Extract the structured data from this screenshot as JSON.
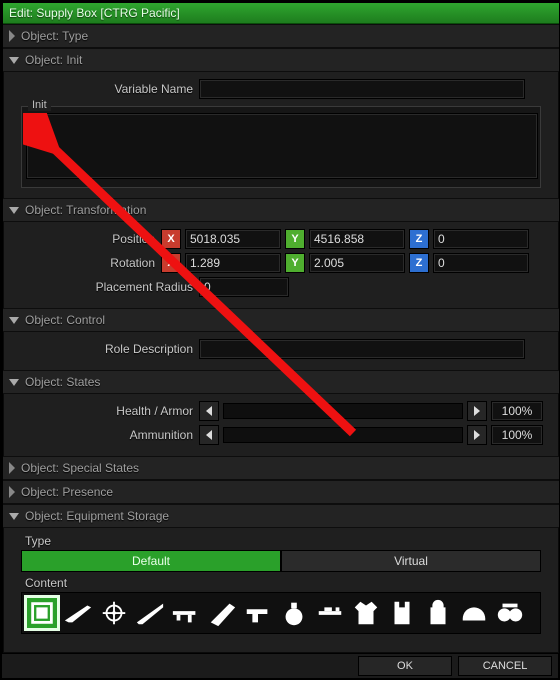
{
  "window": {
    "title": "Edit: Supply Box [CTRG Pacific]"
  },
  "sections": {
    "type": {
      "label": "Object: Type",
      "open": false
    },
    "init": {
      "label": "Object: Init",
      "open": true
    },
    "transformation": {
      "label": "Object: Transformation",
      "open": true
    },
    "control": {
      "label": "Object: Control",
      "open": true
    },
    "states": {
      "label": "Object: States",
      "open": true
    },
    "special_states": {
      "label": "Object: Special States",
      "open": false
    },
    "presence": {
      "label": "Object: Presence",
      "open": false
    },
    "equipment": {
      "label": "Object: Equipment Storage",
      "open": true
    }
  },
  "init": {
    "variable_name_label": "Variable Name",
    "variable_name_value": "",
    "fieldset_legend": "Init",
    "init_value": ""
  },
  "transformation": {
    "position_label": "Position",
    "rotation_label": "Rotation",
    "placement_radius_label": "Placement Radius",
    "axis": {
      "x": "X",
      "y": "Y",
      "z": "Z"
    },
    "position": {
      "x": "5018.035",
      "y": "4516.858",
      "z": "0"
    },
    "rotation": {
      "x": "1.289",
      "y": "2.005",
      "z": "0"
    },
    "placement_radius": "0"
  },
  "control": {
    "role_description_label": "Role Description",
    "role_description_value": ""
  },
  "states": {
    "health_label": "Health / Armor",
    "ammo_label": "Ammunition",
    "health_value": "100%",
    "ammo_value": "100%"
  },
  "equipment": {
    "type_label": "Type",
    "content_label": "Content",
    "tab_default": "Default",
    "tab_virtual": "Virtual",
    "active_tab": "Default",
    "categories": [
      "crate",
      "rifle",
      "scope",
      "sniper",
      "machinegun",
      "launcher",
      "pistol",
      "grenade",
      "attachment",
      "uniform",
      "vest",
      "backpack",
      "helmet",
      "nvg"
    ],
    "active_category": "crate"
  },
  "buttons": {
    "ok": "OK",
    "cancel": "CANCEL"
  }
}
